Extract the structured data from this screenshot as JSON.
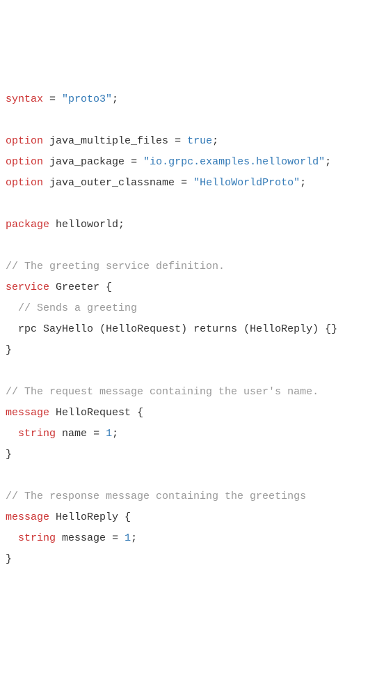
{
  "code": {
    "lines": [
      [
        {
          "cls": "kw",
          "t": "syntax"
        },
        {
          "cls": "punct",
          "t": " = "
        },
        {
          "cls": "str",
          "t": "\"proto3\""
        },
        {
          "cls": "punct",
          "t": ";"
        }
      ],
      [],
      [
        {
          "cls": "kw",
          "t": "option"
        },
        {
          "cls": "punct",
          "t": " "
        },
        {
          "cls": "ident",
          "t": "java_multiple_files"
        },
        {
          "cls": "punct",
          "t": " = "
        },
        {
          "cls": "bool",
          "t": "true"
        },
        {
          "cls": "punct",
          "t": ";"
        }
      ],
      [
        {
          "cls": "kw",
          "t": "option"
        },
        {
          "cls": "punct",
          "t": " "
        },
        {
          "cls": "ident",
          "t": "java_package"
        },
        {
          "cls": "punct",
          "t": " = "
        },
        {
          "cls": "str",
          "t": "\"io.grpc.examples.helloworld\""
        },
        {
          "cls": "punct",
          "t": ";"
        }
      ],
      [
        {
          "cls": "kw",
          "t": "option"
        },
        {
          "cls": "punct",
          "t": " "
        },
        {
          "cls": "ident",
          "t": "java_outer_classname"
        },
        {
          "cls": "punct",
          "t": " = "
        },
        {
          "cls": "str",
          "t": "\"HelloWorldProto\""
        },
        {
          "cls": "punct",
          "t": ";"
        }
      ],
      [],
      [
        {
          "cls": "kw",
          "t": "package"
        },
        {
          "cls": "punct",
          "t": " "
        },
        {
          "cls": "ident",
          "t": "helloworld"
        },
        {
          "cls": "punct",
          "t": ";"
        }
      ],
      [],
      [
        {
          "cls": "comment",
          "t": "// The greeting service definition."
        }
      ],
      [
        {
          "cls": "kw",
          "t": "service"
        },
        {
          "cls": "punct",
          "t": " "
        },
        {
          "cls": "ident",
          "t": "Greeter"
        },
        {
          "cls": "punct",
          "t": " {"
        }
      ],
      [
        {
          "cls": "punct",
          "t": "  "
        },
        {
          "cls": "comment",
          "t": "// Sends a greeting"
        }
      ],
      [
        {
          "cls": "punct",
          "t": "  "
        },
        {
          "cls": "ident",
          "t": "rpc"
        },
        {
          "cls": "punct",
          "t": " "
        },
        {
          "cls": "ident",
          "t": "SayHello"
        },
        {
          "cls": "punct",
          "t": " ("
        },
        {
          "cls": "ident",
          "t": "HelloRequest"
        },
        {
          "cls": "punct",
          "t": ") "
        },
        {
          "cls": "ident",
          "t": "returns"
        },
        {
          "cls": "punct",
          "t": " ("
        },
        {
          "cls": "ident",
          "t": "HelloReply"
        },
        {
          "cls": "punct",
          "t": ") {}"
        }
      ],
      [
        {
          "cls": "punct",
          "t": "}"
        }
      ],
      [],
      [
        {
          "cls": "comment",
          "t": "// The request message containing the user's name."
        }
      ],
      [
        {
          "cls": "kw",
          "t": "message"
        },
        {
          "cls": "punct",
          "t": " "
        },
        {
          "cls": "ident",
          "t": "HelloRequest"
        },
        {
          "cls": "punct",
          "t": " {"
        }
      ],
      [
        {
          "cls": "punct",
          "t": "  "
        },
        {
          "cls": "kw",
          "t": "string"
        },
        {
          "cls": "punct",
          "t": " "
        },
        {
          "cls": "ident",
          "t": "name"
        },
        {
          "cls": "punct",
          "t": " = "
        },
        {
          "cls": "num",
          "t": "1"
        },
        {
          "cls": "punct",
          "t": ";"
        }
      ],
      [
        {
          "cls": "punct",
          "t": "}"
        }
      ],
      [],
      [
        {
          "cls": "comment",
          "t": "// The response message containing the greetings"
        }
      ],
      [
        {
          "cls": "kw",
          "t": "message"
        },
        {
          "cls": "punct",
          "t": " "
        },
        {
          "cls": "ident",
          "t": "HelloReply"
        },
        {
          "cls": "punct",
          "t": " {"
        }
      ],
      [
        {
          "cls": "punct",
          "t": "  "
        },
        {
          "cls": "kw",
          "t": "string"
        },
        {
          "cls": "punct",
          "t": " "
        },
        {
          "cls": "ident",
          "t": "message"
        },
        {
          "cls": "punct",
          "t": " = "
        },
        {
          "cls": "num",
          "t": "1"
        },
        {
          "cls": "punct",
          "t": ";"
        }
      ],
      [
        {
          "cls": "punct",
          "t": "}"
        }
      ]
    ]
  }
}
